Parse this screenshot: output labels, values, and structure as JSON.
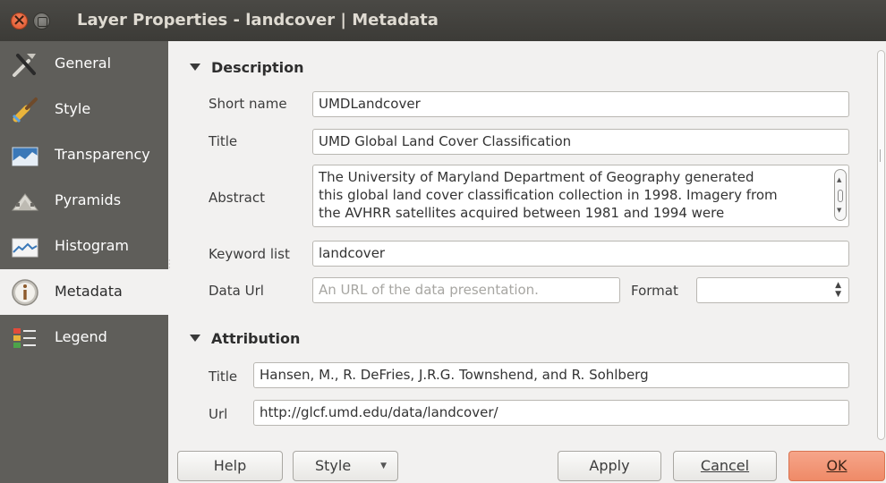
{
  "window": {
    "title": "Layer Properties - landcover | Metadata"
  },
  "sidebar": {
    "items": [
      {
        "label": "General",
        "icon": "general-tools-icon"
      },
      {
        "label": "Style",
        "icon": "style-brush-icon"
      },
      {
        "label": "Transparency",
        "icon": "transparency-icon"
      },
      {
        "label": "Pyramids",
        "icon": "pyramids-icon"
      },
      {
        "label": "Histogram",
        "icon": "histogram-icon"
      },
      {
        "label": "Metadata",
        "icon": "metadata-info-icon",
        "active": true
      },
      {
        "label": "Legend",
        "icon": "legend-icon"
      }
    ]
  },
  "description": {
    "header": "Description",
    "short_name_label": "Short name",
    "short_name_value": "UMDLandcover",
    "title_label": "Title",
    "title_value": "UMD Global Land Cover Classification",
    "abstract_label": "Abstract",
    "abstract_lines": [
      "The University of Maryland Department of Geography generated",
      "this global land cover classification collection in 1998. Imagery from",
      "the AVHRR satellites acquired between 1981 and 1994 were"
    ],
    "keyword_label": "Keyword list",
    "keyword_value": "landcover",
    "data_url_label": "Data Url",
    "data_url_placeholder": "An URL of the data presentation.",
    "format_label": "Format",
    "format_value": ""
  },
  "attribution": {
    "header": "Attribution",
    "title_label": "Title",
    "title_value": "Hansen, M., R. DeFries, J.R.G. Townshend, and R. Sohlberg",
    "url_label": "Url",
    "url_value": "http://glcf.umd.edu/data/landcover/"
  },
  "buttons": {
    "help": "Help",
    "style": "Style",
    "apply": "Apply",
    "cancel": "Cancel",
    "ok": "OK"
  },
  "colors": {
    "sidebar_bg": "#5f5e5a",
    "titlebar_bg": "#3c3b37",
    "ok_accent": "#ef8a67"
  }
}
